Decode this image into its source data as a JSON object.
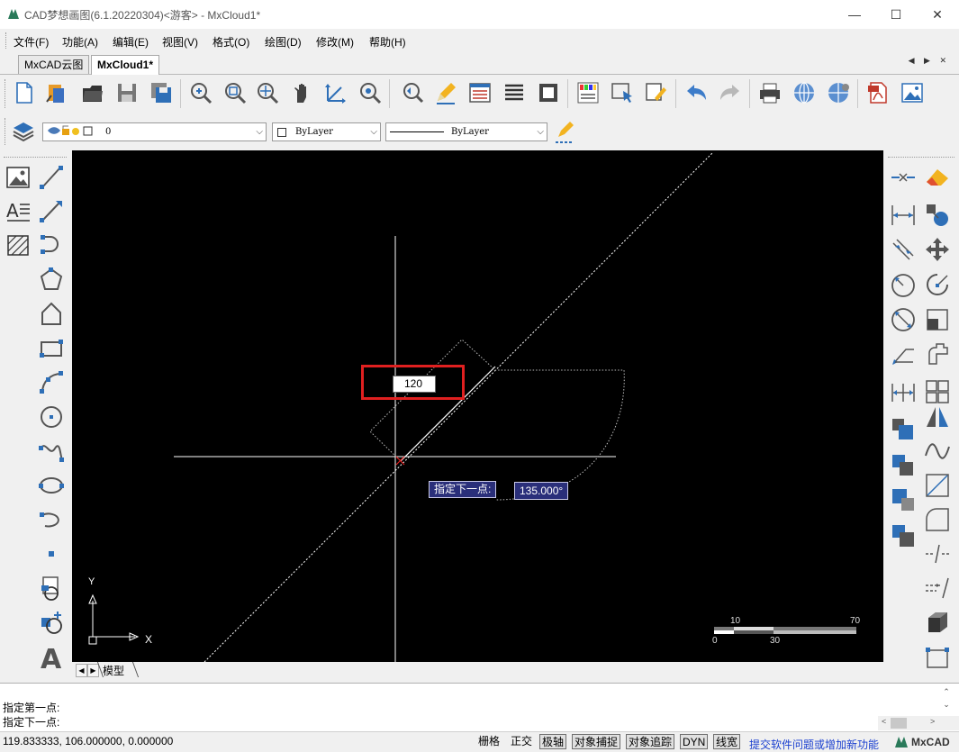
{
  "window": {
    "title": "CAD梦想画图(6.1.20220304)<游客> - MxCloud1*",
    "minimize_glyph": "—",
    "maximize_glyph": "☐",
    "close_glyph": "✕"
  },
  "menu": [
    "文件(F)",
    "功能(A)",
    "编辑(E)",
    "视图(V)",
    "格式(O)",
    "绘图(D)",
    "修改(M)",
    "帮助(H)"
  ],
  "tabs": [
    {
      "label": "MxCAD云图",
      "active": false
    },
    {
      "label": "MxCloud1*",
      "active": true
    }
  ],
  "tab_nav": "◀ ▶ ✕",
  "layer_bar": {
    "layer_value": "0",
    "color_value": "ByLayer",
    "linetype_value": "ByLayer"
  },
  "canvas": {
    "dimension_input": "120",
    "prompt_label": "指定下一点:",
    "angle_value": "135.000°",
    "ucs_x": "X",
    "ucs_y": "Y",
    "scale_top": [
      "10",
      "70"
    ],
    "scale_bottom": [
      "0",
      "30"
    ],
    "model_tab": "模型"
  },
  "command": {
    "line1": "指定第一点:",
    "line2": "指定下一点:"
  },
  "status": {
    "coords": "119.833333,  106.000000,  0.000000",
    "toggles": [
      {
        "label": "栅格",
        "on": false
      },
      {
        "label": "正交",
        "on": false
      },
      {
        "label": "极轴",
        "on": true
      },
      {
        "label": "对象捕捉",
        "on": true
      },
      {
        "label": "对象追踪",
        "on": true
      },
      {
        "label": "DYN",
        "on": true
      },
      {
        "label": "线宽",
        "on": true
      }
    ],
    "feedback_link": "提交软件问题或增加新功能",
    "brand": "MxCAD"
  },
  "colors": {
    "accent": "#2e6fb7",
    "highlight_box": "#e02020",
    "feedback_link": "#1a3fcf",
    "canvas_bg": "#000000",
    "tooltip_bg": "#2a2f7a"
  },
  "icons": {
    "toolbar_main": [
      "new-file-icon",
      "open-file-icon",
      "folder-icon",
      "save-icon",
      "save-all-icon",
      "zoom-window-icon",
      "zoom-extents-icon",
      "zoom-realtime-icon",
      "pan-hand-icon",
      "ucs-icon",
      "zoom-previous-icon",
      "undo-view-icon",
      "pencil-icon",
      "properties-icon",
      "list-icon",
      "block-icon",
      "color-palette-icon",
      "select-icon",
      "match-properties-icon",
      "undo-icon",
      "redo-icon",
      "print-icon",
      "globe-icon",
      "globe-settings-icon",
      "pdf-icon",
      "image-icon"
    ],
    "left_draw": [
      "insert-image-icon",
      "line-icon",
      "text-icon",
      "ray-icon",
      "hatch-icon",
      "arc-icon",
      "polygon-icon",
      "pentagon-icon",
      "rectangle-icon",
      "arc-3pt-icon",
      "circle-icon",
      "spline-icon",
      "ellipse-icon",
      "ellipse-arc-icon",
      "point-icon",
      "block-insert-icon",
      "block-create-icon",
      "mtext-icon"
    ],
    "right_modify": [
      "join-icon",
      "erase-icon",
      "dimension-linear-icon",
      "copy-icon",
      "dimension-aligned-icon",
      "move-icon",
      "dimension-radius-icon",
      "rotate-icon",
      "dimension-diameter-icon",
      "scale-icon",
      "leader-icon",
      "offset-icon",
      "dimension-continue-icon",
      "array-icon",
      "layer-front-icon",
      "mirror-icon",
      "layer-back-icon",
      "wave-icon",
      "layer-above-icon",
      "trim-icon",
      "layer-below-icon",
      "fillet-icon",
      "break-icon",
      "extend-icon",
      "3d-box-icon",
      "stretch-icon"
    ]
  }
}
